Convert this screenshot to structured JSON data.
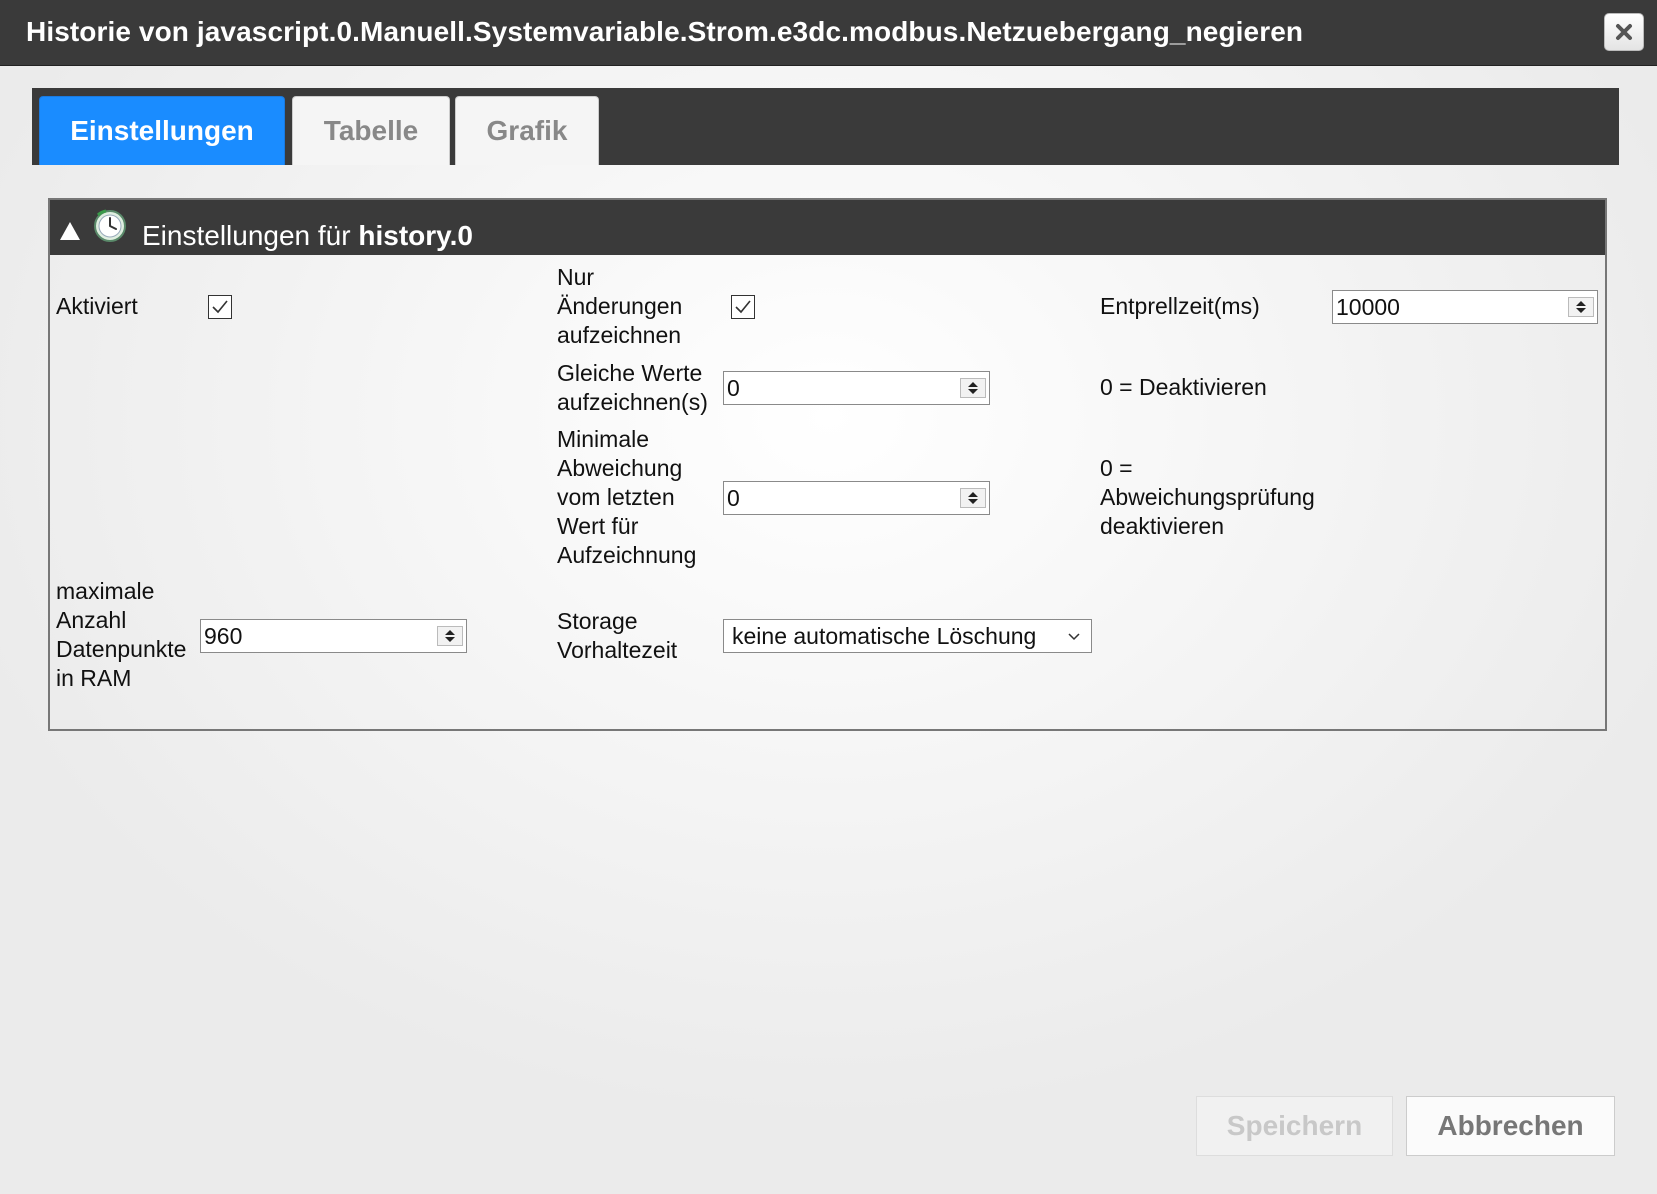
{
  "window": {
    "title": "Historie von javascript.0.Manuell.Systemvariable.Strom.e3dc.modbus.Netzuebergang_negieren"
  },
  "tabs": [
    {
      "label": "Einstellungen",
      "active": true
    },
    {
      "label": "Tabelle",
      "active": false
    },
    {
      "label": "Grafik",
      "active": false
    }
  ],
  "panel": {
    "title_prefix": "Einstellungen für",
    "instance": "history.0"
  },
  "fields": {
    "enabled": {
      "label": "Aktiviert",
      "checked": true
    },
    "changes_only": {
      "label": "Nur Änderungen aufzeichnen",
      "checked": true
    },
    "debounce": {
      "label": "Entprellzeit(ms)",
      "value": "10000"
    },
    "same_values": {
      "label": "Gleiche Werte aufzeichnen(s)",
      "value": "0",
      "hint": "0 = Deaktivieren"
    },
    "min_deviation": {
      "label": "Minimale Abweichung vom letzten Wert für Aufzeichnung",
      "value": "0",
      "hint": "0 = Abweichungsprüfung deaktivieren"
    },
    "max_ram": {
      "label": "maximale Anzahl Datenpunkte in RAM",
      "value": "960"
    },
    "retention": {
      "label": "Storage Vorhaltezeit",
      "value": "keine automatische Löschung"
    }
  },
  "buttons": {
    "save": "Speichern",
    "cancel": "Abbrechen"
  },
  "colors": {
    "active_tab": "#1a8cff",
    "header_bg": "#3a3a3a"
  }
}
